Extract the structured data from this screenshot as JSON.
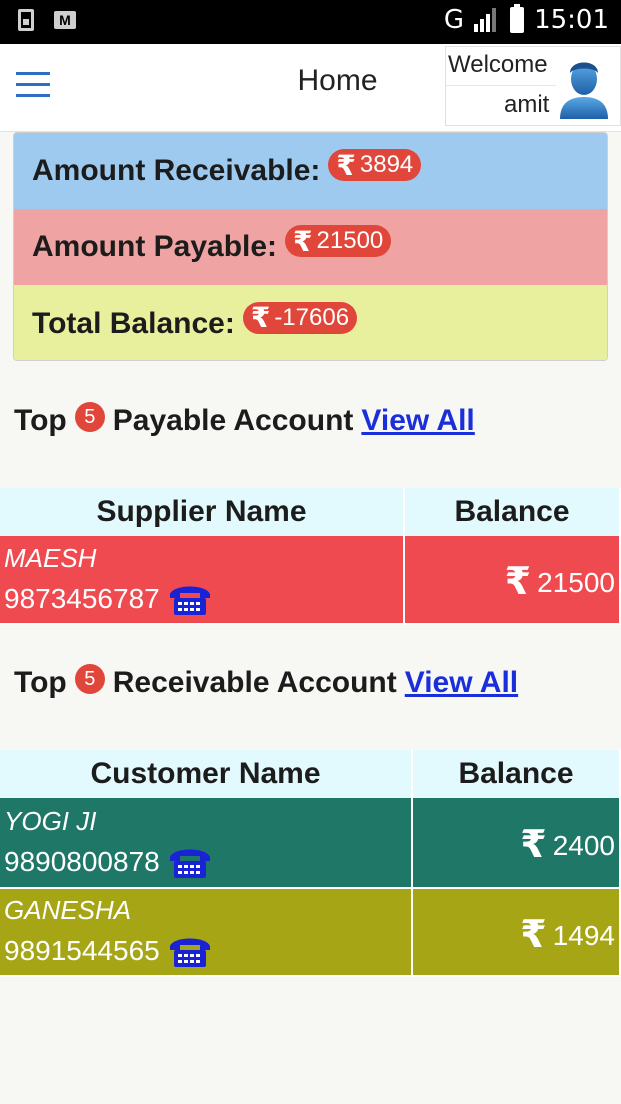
{
  "status_bar": {
    "network": "G",
    "time": "15:01"
  },
  "app_bar": {
    "title": "Home",
    "welcome": "Welcome",
    "username": "amit"
  },
  "summary": {
    "receivable_label": "Amount Receivable:",
    "receivable_value": "3894",
    "payable_label": "Amount Payable:",
    "payable_value": "21500",
    "balance_label": "Total Balance:",
    "balance_value": "-17606",
    "currency": "₹"
  },
  "payable_section": {
    "prefix": "Top",
    "count": "5",
    "suffix": "Payable Account",
    "view_all": "View All",
    "col_name": "Supplier Name",
    "col_balance": "Balance",
    "rows": [
      {
        "name": "MAESH",
        "phone": "9873456787",
        "balance": "21500",
        "color": "#ef4a4f"
      }
    ]
  },
  "receivable_section": {
    "prefix": "Top",
    "count": "5",
    "suffix": "Receivable Account",
    "view_all": "View All",
    "col_name": "Customer Name",
    "col_balance": "Balance",
    "rows": [
      {
        "name": "YOGI JI",
        "phone": "9890800878",
        "balance": "2400",
        "color": "#1f7767"
      },
      {
        "name": "GANESHA",
        "phone": "9891544565",
        "balance": "1494",
        "color": "#a6a516"
      }
    ]
  },
  "icons": {
    "menu": "hamburger-menu-icon",
    "avatar": "user-avatar-icon",
    "phone": "telephone-icon",
    "currency": "rupee-icon"
  },
  "colors": {
    "receivable_bg": "#9ecaef",
    "payable_bg": "#efa3a3",
    "balance_bg": "#e8ef9d",
    "badge": "#e0463a",
    "link": "#1a2fd9"
  }
}
